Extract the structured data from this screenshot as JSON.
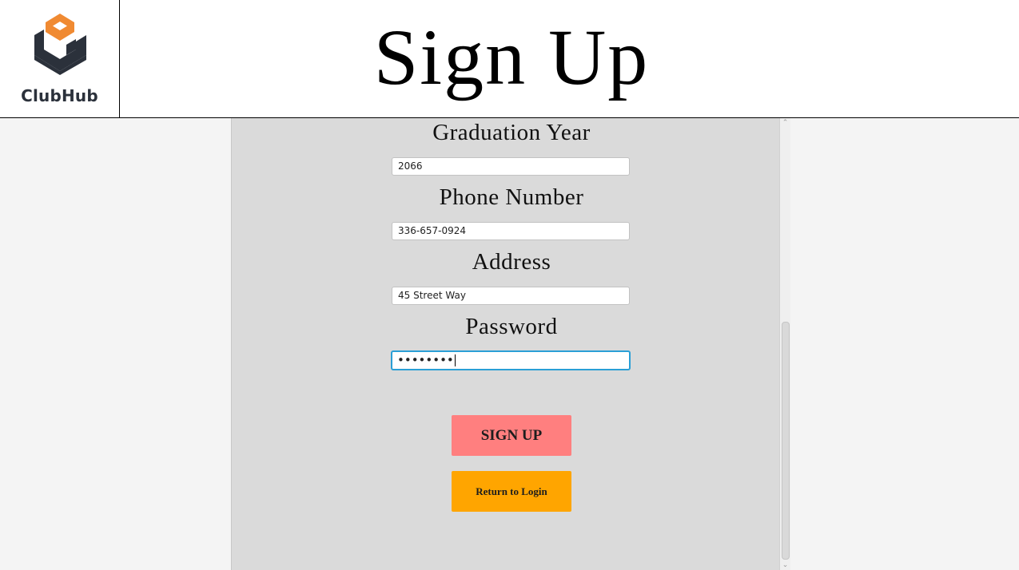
{
  "header": {
    "logo_text": "ClubHub",
    "title": "Sign Up"
  },
  "form": {
    "graduation_year": {
      "label": "Graduation Year",
      "value": "2066"
    },
    "phone_number": {
      "label": "Phone Number",
      "value": "336-657-0924"
    },
    "address": {
      "label": "Address",
      "value": "45 Street Way"
    },
    "password": {
      "label": "Password",
      "value": "••••••••"
    }
  },
  "buttons": {
    "sign_up": "SIGN UP",
    "return_to_login": "Return to Login"
  },
  "icons": {
    "logo": "clubhub-logo-icon",
    "scroll_up": "chevron-up-icon",
    "scroll_down": "chevron-down-icon"
  },
  "colors": {
    "logo_orange": "#f08a32",
    "logo_dark": "#2b313b",
    "sign_up_button": "#ff7f7f",
    "return_button": "#ffa500",
    "panel_background": "#dadada",
    "focus_ring": "#2a9fd6"
  }
}
